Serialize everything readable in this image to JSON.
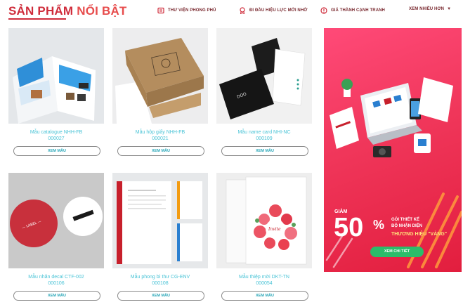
{
  "header": {
    "title_part1": "SẢN PHẨM",
    "title_part2": "NỔI BẬT",
    "nav": [
      {
        "label": "THƯ VIỆN PHONG PHÚ",
        "icon": "book-icon"
      },
      {
        "label": "ĐI ĐẦU HIỆU LỰC MỚI NHỜ",
        "icon": "award-icon"
      },
      {
        "label": "GIÁ THÀNH CẠNH TRANH",
        "icon": "info-icon"
      },
      {
        "label": "XEM NHIỀU HƠN",
        "icon": "chevron-down-icon"
      }
    ]
  },
  "cards": [
    {
      "caption_line1": "Mẫu catalogue NHH-FB",
      "caption_line2": "000027",
      "button": "XEM MẪU"
    },
    {
      "caption_line1": "Mẫu hộp giấy NHH-FB",
      "caption_line2": "000021",
      "button": "XEM MẪU"
    },
    {
      "caption_line1": "Mẫu name card NHI-NC",
      "caption_line2": "000109",
      "button": "XEM MẪU"
    },
    {
      "caption_line1": "Mẫu nhãn decal CTF-002",
      "caption_line2": "000106",
      "button": "XEM MẪU"
    },
    {
      "caption_line1": "Mẫu phong bì thư CG-ENV",
      "caption_line2": "000108",
      "button": "XEM MẪU"
    },
    {
      "caption_line1": "Mẫu thiệp mời DKT-TN",
      "caption_line2": "000054",
      "button": "XEM MẪU"
    }
  ],
  "banner": {
    "giam": "GIẢM",
    "value": "50",
    "percent": "%",
    "line1": "GÓI THIẾT KẾ",
    "line2": "BỘ NHẬN DIỆN",
    "line3": "THƯƠNG HIỆU \"VÀNG\"",
    "cta": "XEM CHI TIẾT"
  },
  "colors": {
    "title_red": "#cf2b3a",
    "caption_teal": "#48c3d6",
    "banner_pink": "#f0365a",
    "cta_green": "#2bbd6a"
  }
}
